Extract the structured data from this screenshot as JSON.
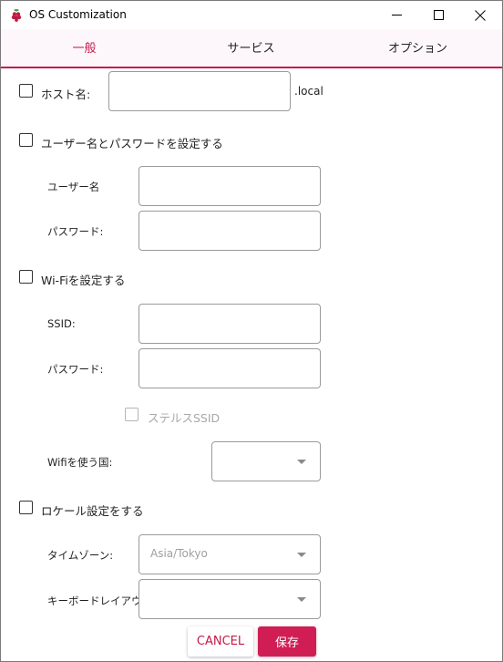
{
  "window": {
    "title": "OS Customization"
  },
  "tabs": [
    {
      "label": "一般",
      "active": true
    },
    {
      "label": "サービス",
      "active": false
    },
    {
      "label": "オプション",
      "active": false
    }
  ],
  "hostname": {
    "label": "ホスト名:",
    "value": "",
    "suffix": ".local",
    "checked": false
  },
  "user": {
    "label": "ユーザー名とパスワードを設定する",
    "checked": false,
    "username_label": "ユーザー名",
    "username_value": "",
    "password_label": "パスワード:",
    "password_value": ""
  },
  "wifi": {
    "label": "Wi-Fiを設定する",
    "checked": false,
    "ssid_label": "SSID:",
    "ssid_value": "",
    "password_label": "パスワード:",
    "password_value": "",
    "stealth_label": "ステルスSSID",
    "stealth_checked": false,
    "country_label": "Wifiを使う国:",
    "country_value": ""
  },
  "locale": {
    "label": "ロケール設定をする",
    "checked": false,
    "timezone_label": "タイムゾーン:",
    "timezone_value": "Asia/Tokyo",
    "keyboard_label": "キーボードレイアウト:",
    "keyboard_value": ""
  },
  "buttons": {
    "cancel": "CANCEL",
    "save": "保存"
  },
  "colors": {
    "accent": "#c51a4a",
    "save_bg": "#d01e55",
    "tab_bg": "#fdf7fb"
  }
}
